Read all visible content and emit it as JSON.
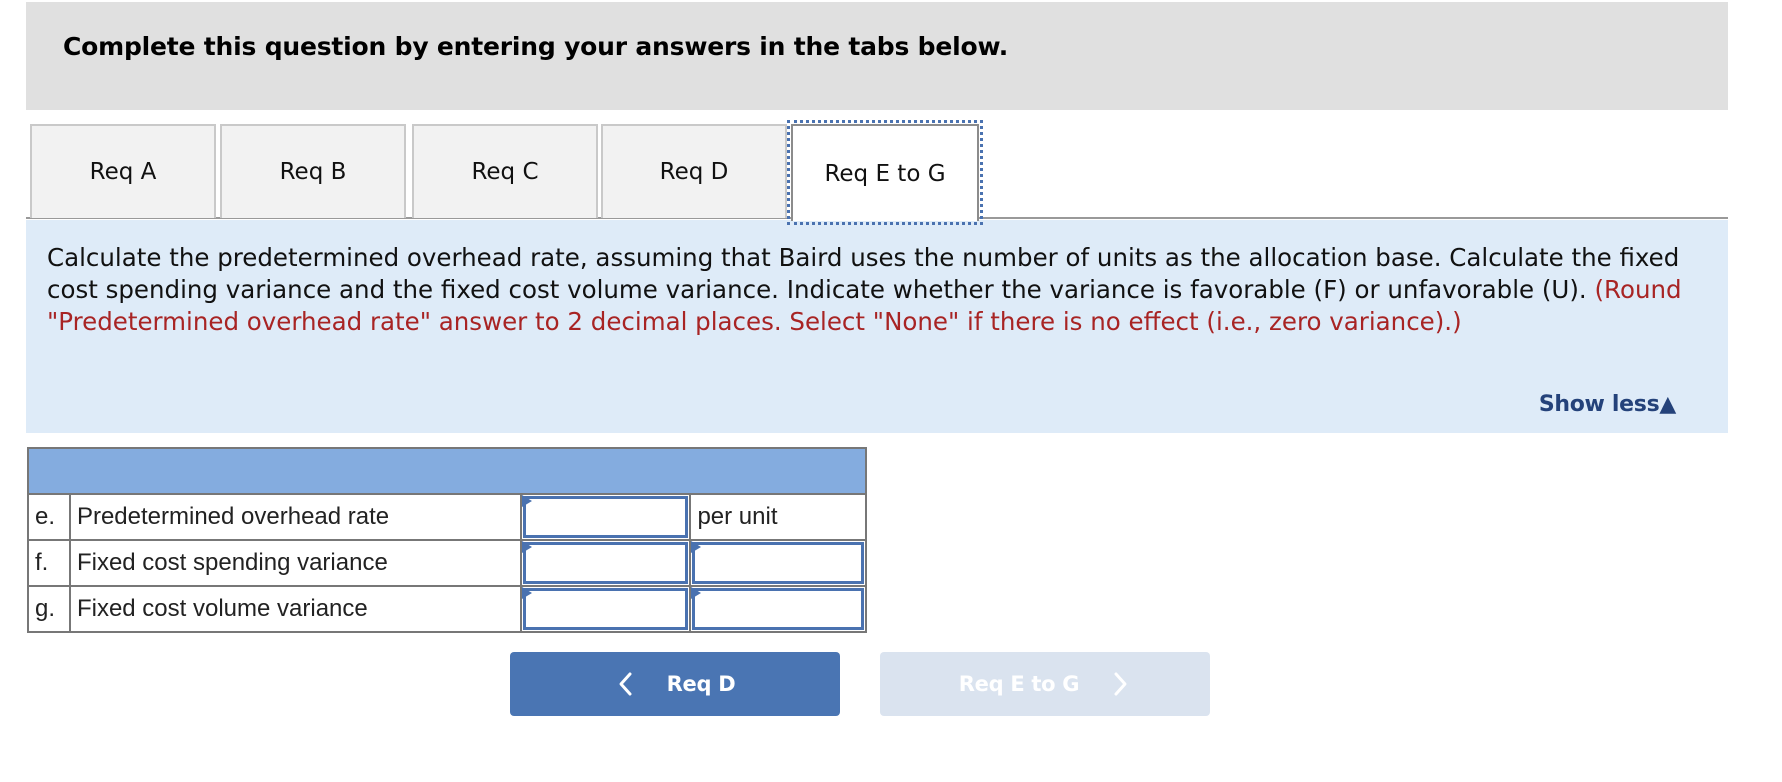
{
  "header": {
    "title": "Complete this question by entering your answers in the tabs below."
  },
  "tabs": [
    {
      "label": "Req A",
      "active": false
    },
    {
      "label": "Req B",
      "active": false
    },
    {
      "label": "Req C",
      "active": false
    },
    {
      "label": "Req D",
      "active": false
    },
    {
      "label": "Req E to G",
      "active": true
    }
  ],
  "prompt": {
    "instruction": "Calculate the predetermined overhead rate, assuming that Baird uses the number of units as the allocation base. Calculate the fixed cost spending variance and the fixed cost volume variance. Indicate whether the variance is favorable (F) or unfavorable (U). ",
    "note": "(Round \"Predetermined overhead rate\" answer to 2 decimal places. Select \"None\" if there is no effect (i.e., zero variance).)",
    "toggle_label": "Show less",
    "toggle_icon": "triangle-up-icon"
  },
  "table": {
    "header_color": "#84acdf",
    "rows": [
      {
        "letter": "e.",
        "label": "Predetermined overhead rate",
        "value": "",
        "unit": "per unit",
        "unit_is_select": false
      },
      {
        "letter": "f.",
        "label": "Fixed cost spending variance",
        "value": "",
        "unit": "",
        "unit_is_select": true
      },
      {
        "letter": "g.",
        "label": "Fixed cost volume variance",
        "value": "",
        "unit": "",
        "unit_is_select": true
      }
    ]
  },
  "nav": {
    "prev_label": "Req D",
    "prev_icon": "chevron-left-icon",
    "next_label": "Req E to G",
    "next_icon": "chevron-right-icon",
    "next_disabled": true
  },
  "colors": {
    "accent": "#4a75b3",
    "note_red": "#a82424",
    "panel_bg": "#deebf8",
    "header_bg": "#e0e0e0",
    "link": "#24427a"
  }
}
